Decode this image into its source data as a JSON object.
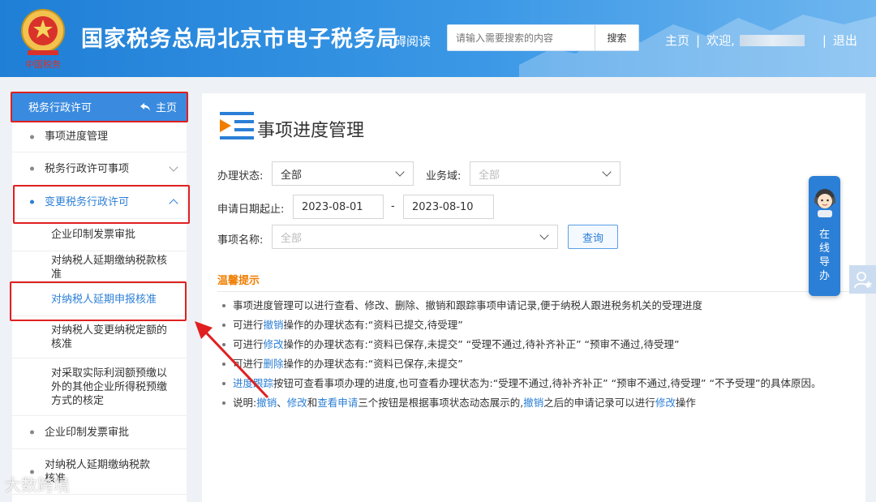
{
  "header": {
    "site_title": "国家税务总局北京市电子税务局",
    "accessible_reading": "碍阅读",
    "search_placeholder": "请输入需要搜索的内容",
    "search_button": "搜索",
    "home_link": "主页",
    "welcome": "欢迎,",
    "logout": "退出",
    "sep": "|"
  },
  "sidebar": {
    "head_title": "税务行政许可",
    "head_home": "主页",
    "items": [
      {
        "label": "事项进度管理"
      },
      {
        "label": "税务行政许可事项"
      },
      {
        "label": "变更税务行政许可"
      },
      {
        "label": "企业印制发票审批"
      },
      {
        "label": "对纳税人延期缴纳税款核准"
      },
      {
        "label": "对纳税人延期申报核准"
      },
      {
        "label": "对纳税人变更纳税定额的核准"
      },
      {
        "label": "对采取实际利润额预缴以外的其他企业所得税预缴方式的核定"
      },
      {
        "label": "企业印制发票审批"
      },
      {
        "label": "对纳税人延期缴纳税款核准"
      }
    ]
  },
  "main": {
    "title": "事项进度管理",
    "form": {
      "status_label": "办理状态:",
      "status_value": "全部",
      "domain_label": "业务域:",
      "domain_value": "全部",
      "date_label": "申请日期起止:",
      "date_start": "2023-08-01",
      "date_sep": "-",
      "date_end": "2023-08-10",
      "item_label": "事项名称:",
      "item_value": "全部",
      "query_button": "查询"
    },
    "tips_title": "温馨提示",
    "tips": {
      "t1": "事项进度管理可以进行查看、修改、删除、撤销和跟踪事项申请记录,便于纳税人跟进税务机关的受理进度",
      "t2_pre": "可进行",
      "t2_link": "撤销",
      "t2_post": "操作的办理状态有:“资料已提交,待受理”",
      "t3_pre": "可进行",
      "t3_link": "修改",
      "t3_post": "操作的办理状态有:“资料已保存,未提交” “受理不通过,待补齐补正” “预审不通过,待受理”",
      "t4_pre": "可进行",
      "t4_link": "删除",
      "t4_post": "操作的办理状态有:“资料已保存,未提交”",
      "t5_link": "进度跟踪",
      "t5_post": "按钮可查看事项办理的进度,也可查看办理状态为:“受理不通过,待补齐补正” “预审不通过,待受理” “不予受理”的具体原因。",
      "t6_pre": "说明:",
      "t6_l1": "撤销",
      "t6_s1": "、",
      "t6_l2": "修改",
      "t6_s2": "和",
      "t6_l3": "查看申请",
      "t6_s3": "三个按钮是根据事项状态动态展示的,",
      "t6_l4": "撤销",
      "t6_s4": "之后的申请记录可以进行",
      "t6_l5": "修改",
      "t6_s5": "操作"
    }
  },
  "guide": {
    "chars": [
      "在",
      "线",
      "导",
      "办"
    ]
  },
  "watermark": "大数跨境",
  "colors": {
    "header_blue": "#2b86dc",
    "accent": "#2b7fd6",
    "tips_orange": "#f07d00",
    "highlight_red": "#e02020"
  }
}
